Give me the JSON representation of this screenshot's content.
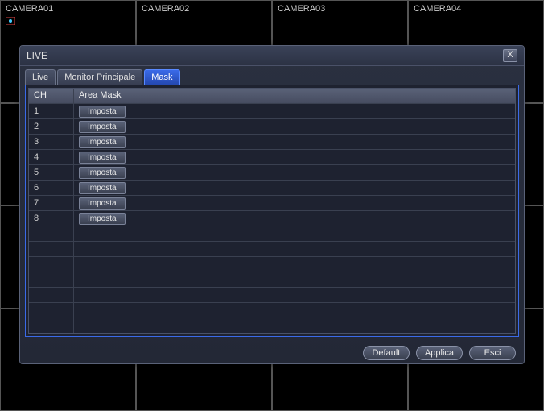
{
  "cameras": [
    "CAMERA01",
    "CAMERA02",
    "CAMERA03",
    "CAMERA04"
  ],
  "dialog": {
    "title": "LIVE",
    "tabs": [
      "Live",
      "Monitor Principale",
      "Mask"
    ],
    "active_tab_index": 2,
    "table": {
      "header_ch": "CH",
      "header_area": "Area Mask",
      "total_rows": 15,
      "rows": [
        {
          "ch": "1",
          "button": "Imposta"
        },
        {
          "ch": "2",
          "button": "Imposta"
        },
        {
          "ch": "3",
          "button": "Imposta"
        },
        {
          "ch": "4",
          "button": "Imposta"
        },
        {
          "ch": "5",
          "button": "Imposta"
        },
        {
          "ch": "6",
          "button": "Imposta"
        },
        {
          "ch": "7",
          "button": "Imposta"
        },
        {
          "ch": "8",
          "button": "Imposta"
        }
      ]
    },
    "footer": {
      "default": "Default",
      "apply": "Applica",
      "exit": "Esci"
    }
  }
}
